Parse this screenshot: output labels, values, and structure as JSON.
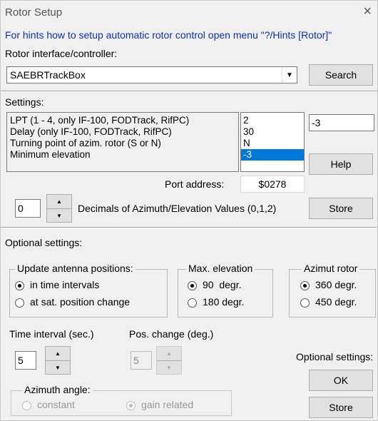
{
  "window": {
    "title": "Rotor Setup",
    "close_glyph": "×"
  },
  "hint": "For hints  how to setup automatic rotor control open menu \"?/Hints [Rotor]\"",
  "rotor": {
    "label": "Rotor interface/controller:",
    "value": "SAEBRTrackBox",
    "search_label": "Search"
  },
  "settings": {
    "label": "Settings:",
    "items": [
      "LPT (1 - 4, only IF-100, FODTrack, RifPC)",
      "Delay (only IF-100, FODTrack, RifPC)",
      "Turning point of azim. rotor (S or N)",
      "Minimum elevation"
    ],
    "values": [
      "2",
      "30",
      "N",
      "-3"
    ],
    "selected_index": 3,
    "edit_value": "-3",
    "help_label": "Help"
  },
  "port": {
    "label": "Port address:",
    "value": "$0278"
  },
  "decimals": {
    "value": "0",
    "label": "Decimals of Azimuth/Elevation Values (0,1,2)",
    "store_label": "Store"
  },
  "optional": {
    "label": "Optional settings:",
    "update_group": {
      "title": "Update antenna positions:",
      "options": [
        "in time intervals",
        "at sat. position change"
      ],
      "selected": 0
    },
    "elev_group": {
      "title": "Max. elevation",
      "options": [
        "90  degr.",
        "180 degr."
      ],
      "selected": 0
    },
    "azimut_group": {
      "title": "Azimut rotor",
      "options": [
        "360 degr.",
        "450 degr."
      ],
      "selected": 0
    },
    "time_interval": {
      "label": "Time interval (sec.)",
      "value": "5"
    },
    "pos_change": {
      "label": "Pos. change (deg.)",
      "value": "5"
    },
    "azimuth_angle": {
      "title": "Azimuth angle:",
      "options": [
        "constant",
        "gain related"
      ],
      "selected": 1
    },
    "right_label": "Optional settings:",
    "ok_label": "OK",
    "store_label": "Store"
  }
}
